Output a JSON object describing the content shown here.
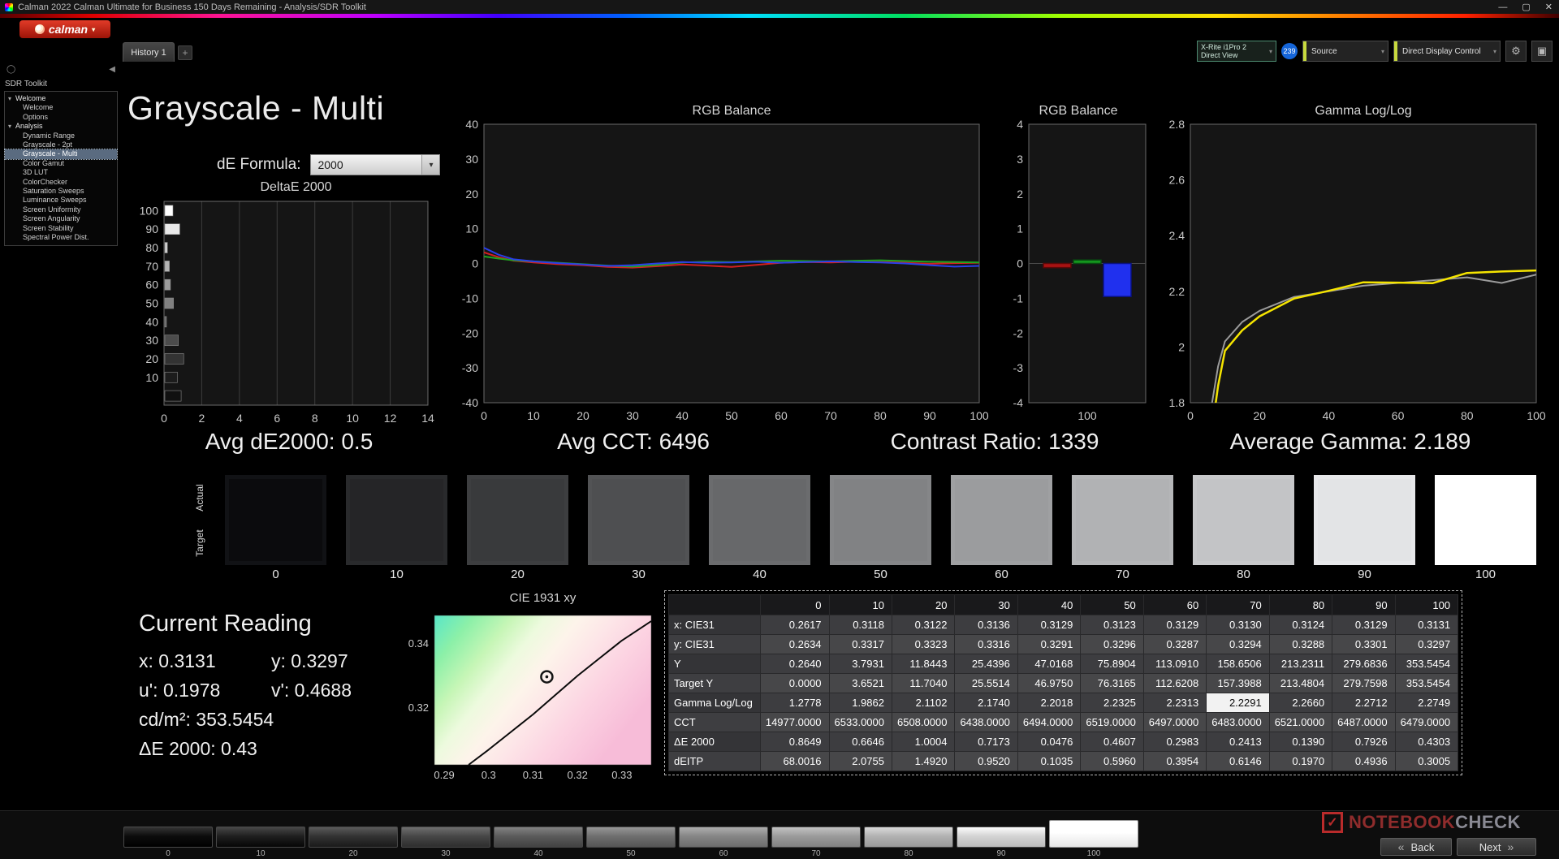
{
  "window": {
    "title": "Calman 2022 Calman Ultimate for Business 150 Days Remaining  - Analysis/SDR Toolkit",
    "minimize": "—",
    "maximize": "▢",
    "close": "✕"
  },
  "logo": {
    "text": "calman",
    "caret": "▾"
  },
  "tabs": {
    "history": "History 1",
    "add": "+"
  },
  "meter_bar": {
    "meter_line1": "X-Rite i1Pro 2",
    "meter_line2": "Direct View",
    "badge": "239",
    "source": "Source",
    "display_control": "Direct Display Control",
    "caret": "▾",
    "gear_icon": "⚙",
    "display_icon": "▣"
  },
  "sidebar": {
    "title": "SDR Toolkit",
    "menu_icon": "◯",
    "collapse_icon": "◀",
    "group_caret": "▾",
    "groups": [
      {
        "label": "Welcome",
        "items": [
          {
            "label": "Welcome"
          },
          {
            "label": "Options"
          }
        ]
      },
      {
        "label": "Analysis",
        "items": [
          {
            "label": "Dynamic Range"
          },
          {
            "label": "Grayscale - 2pt"
          },
          {
            "label": "Grayscale - Multi",
            "selected": true
          },
          {
            "label": "Color Gamut"
          },
          {
            "label": "3D LUT"
          },
          {
            "label": "ColorChecker"
          },
          {
            "label": "Saturation Sweeps"
          },
          {
            "label": "Luminance Sweeps"
          },
          {
            "label": "Screen Uniformity"
          },
          {
            "label": "Screen Angularity"
          },
          {
            "label": "Screen Stability"
          },
          {
            "label": "Spectral Power Dist."
          }
        ]
      }
    ]
  },
  "page": {
    "title": "Grayscale - Multi",
    "de_formula_label": "dE Formula:",
    "de_formula_value": "2000"
  },
  "stats": [
    {
      "id": "avg-de2000",
      "text": "Avg dE2000: 0.5"
    },
    {
      "id": "avg-cct",
      "text": "Avg CCT: 6496"
    },
    {
      "id": "contrast-ratio",
      "text": "Contrast Ratio: 1339"
    },
    {
      "id": "average-gamma",
      "text": "Average Gamma: 2.189"
    }
  ],
  "gray_swatches": {
    "actual_label": "Actual",
    "target_label": "Target",
    "levels": [
      "0",
      "10",
      "20",
      "30",
      "40",
      "50",
      "60",
      "70",
      "80",
      "90",
      "100"
    ],
    "actual_colors": [
      "#0b0b0d",
      "#252527",
      "#393a3c",
      "#4e4f51",
      "#67686a",
      "#818284",
      "#9b9c9e",
      "#b1b2b4",
      "#c3c4c6",
      "#e3e4e6",
      "#ffffff"
    ],
    "target_colors": [
      "#111215",
      "#292a2c",
      "#3d3e40",
      "#525355",
      "#6b6c6e",
      "#858688",
      "#9fa0a2",
      "#b5b6b8",
      "#c7c8ca",
      "#e7e8ea",
      "#ffffff"
    ]
  },
  "current_reading": {
    "title": "Current Reading",
    "rows": [
      [
        "x: 0.3131",
        "y: 0.3297"
      ],
      [
        "u': 0.1978",
        "v': 0.4688"
      ],
      [
        "cd/m²: 353.5454"
      ],
      [
        "ΔE 2000: 0.43"
      ]
    ]
  },
  "table": {
    "columns": [
      "0",
      "10",
      "20",
      "30",
      "40",
      "50",
      "60",
      "70",
      "80",
      "90",
      "100"
    ],
    "rows": [
      {
        "label": "x: CIE31",
        "values": [
          "0.2617",
          "0.3118",
          "0.3122",
          "0.3136",
          "0.3129",
          "0.3123",
          "0.3129",
          "0.3130",
          "0.3124",
          "0.3129",
          "0.3131"
        ]
      },
      {
        "label": "y: CIE31",
        "values": [
          "0.2634",
          "0.3317",
          "0.3323",
          "0.3316",
          "0.3291",
          "0.3296",
          "0.3287",
          "0.3294",
          "0.3288",
          "0.3301",
          "0.3297"
        ]
      },
      {
        "label": "Y",
        "values": [
          "0.2640",
          "3.7931",
          "11.8443",
          "25.4396",
          "47.0168",
          "75.8904",
          "113.0910",
          "158.6506",
          "213.2311",
          "279.6836",
          "353.5454"
        ]
      },
      {
        "label": "Target Y",
        "values": [
          "0.0000",
          "3.6521",
          "11.7040",
          "25.5514",
          "46.9750",
          "76.3165",
          "112.6208",
          "157.3988",
          "213.4804",
          "279.7598",
          "353.5454"
        ]
      },
      {
        "label": "Gamma Log/Log",
        "values": [
          "1.2778",
          "1.9862",
          "2.1102",
          "2.1740",
          "2.2018",
          "2.2325",
          "2.2313",
          "2.2291",
          "2.2660",
          "2.2712",
          "2.2749"
        ]
      },
      {
        "label": "CCT",
        "values": [
          "14977.0000",
          "6533.0000",
          "6508.0000",
          "6438.0000",
          "6494.0000",
          "6519.0000",
          "6497.0000",
          "6483.0000",
          "6521.0000",
          "6487.0000",
          "6479.0000"
        ]
      },
      {
        "label": "ΔE 2000",
        "values": [
          "0.8649",
          "0.6646",
          "1.0004",
          "0.7173",
          "0.0476",
          "0.4607",
          "0.2983",
          "0.2413",
          "0.1390",
          "0.7926",
          "0.4303"
        ]
      },
      {
        "label": "dEITP",
        "values": [
          "68.0016",
          "2.0755",
          "1.4920",
          "0.9520",
          "0.1035",
          "0.5960",
          "0.3954",
          "0.6146",
          "0.1970",
          "0.4936",
          "0.3005"
        ]
      }
    ],
    "highlight": {
      "row_index": 4,
      "col_index": 7
    }
  },
  "bottom_bar": {
    "levels": [
      "0",
      "10",
      "20",
      "30",
      "40",
      "50",
      "60",
      "70",
      "80",
      "90",
      "100"
    ],
    "selected_index": 10,
    "level_colors": [
      "#0c0c0c",
      "#1f1f1f",
      "#333333",
      "#474747",
      "#5b5b5b",
      "#6f6f6f",
      "#868686",
      "#9b9b9b",
      "#b2b2b2",
      "#d4d4d4",
      "#ffffff"
    ],
    "back": "Back",
    "next": "Next",
    "back_chevron": "«",
    "next_chevron": "»"
  },
  "watermark": {
    "check": "✓",
    "text_primary": "NOTEBOOK",
    "text_secondary": "CHECK"
  },
  "chart_data": [
    {
      "id": "deltae",
      "type": "bar",
      "orientation": "horizontal",
      "title": "DeltaE 2000",
      "categories": [
        100,
        90,
        80,
        70,
        60,
        50,
        40,
        30,
        20,
        10,
        0
      ],
      "values": [
        0.4303,
        0.7926,
        0.139,
        0.2413,
        0.2983,
        0.4607,
        0.0476,
        0.7173,
        1.0004,
        0.6646,
        0.8649
      ],
      "xlim": [
        0,
        14
      ],
      "xticks": [
        0,
        2,
        4,
        6,
        8,
        10,
        12,
        14
      ],
      "bar_colors": [
        "#ffffff",
        "#e9e9e9",
        "#cfcfcf",
        "#b5b5b5",
        "#9b9b9b",
        "#808080",
        "#666666",
        "#4c4c4c",
        "#333333",
        "#1c1c1c",
        "#101010"
      ]
    },
    {
      "id": "rgb-line",
      "type": "line",
      "title": "RGB Balance",
      "xlim": [
        0,
        100
      ],
      "ylim": [
        -40,
        40
      ],
      "xticks": [
        0,
        10,
        20,
        30,
        40,
        50,
        60,
        70,
        80,
        90,
        100
      ],
      "yticks": [
        40,
        30,
        20,
        10,
        0,
        -10,
        -20,
        -30,
        -40
      ],
      "x": [
        0,
        3,
        6,
        10,
        15,
        20,
        25,
        30,
        35,
        40,
        45,
        50,
        55,
        60,
        65,
        70,
        75,
        80,
        85,
        90,
        95,
        100
      ],
      "series": [
        {
          "name": "red",
          "color": "#d42020",
          "values": [
            3.2,
            1.8,
            0.8,
            0.3,
            -0.2,
            -0.5,
            -1.0,
            -1.2,
            -0.8,
            -0.3,
            -0.6,
            -1.0,
            -0.4,
            0.2,
            0.4,
            0.3,
            0.5,
            0.4,
            0.2,
            -0.1,
            0.1,
            0.2
          ]
        },
        {
          "name": "green",
          "color": "#1fa51f",
          "values": [
            2.0,
            1.4,
            0.9,
            0.6,
            0.2,
            -0.2,
            -0.6,
            -0.9,
            -0.4,
            0.3,
            0.5,
            0.4,
            0.6,
            0.8,
            0.7,
            0.6,
            0.8,
            0.9,
            0.7,
            0.5,
            0.4,
            0.3
          ]
        },
        {
          "name": "blue",
          "color": "#2a3fe8",
          "values": [
            4.5,
            2.5,
            1.2,
            0.6,
            0.1,
            -0.3,
            -0.7,
            -0.5,
            0.0,
            0.4,
            0.2,
            0.3,
            0.5,
            0.2,
            0.4,
            0.6,
            0.4,
            0.3,
            0.0,
            -0.5,
            -0.9,
            -0.7
          ]
        }
      ]
    },
    {
      "id": "rgb-bar",
      "type": "bar",
      "title": "RGB Balance",
      "ylim": [
        -4,
        4
      ],
      "yticks": [
        4,
        3,
        2,
        1,
        0,
        -1,
        -2,
        -3,
        -4
      ],
      "x_label": "100",
      "series": [
        {
          "name": "red",
          "color": "#a81212",
          "border": "#5c0808",
          "value": -0.12
        },
        {
          "name": "green",
          "color": "#14961e",
          "border": "#084c10",
          "value": 0.1
        },
        {
          "name": "blue",
          "color": "#2030ee",
          "border": "#0a1280",
          "value": -0.95
        }
      ]
    },
    {
      "id": "gamma",
      "type": "line",
      "title": "Gamma Log/Log",
      "xlim": [
        0,
        100
      ],
      "ylim": [
        1.8,
        2.8
      ],
      "xticks": [
        0,
        20,
        40,
        60,
        80,
        100
      ],
      "yticks": [
        2.8,
        2.6,
        2.4,
        2.2,
        2,
        1.8
      ],
      "x": [
        2,
        4,
        6,
        8,
        10,
        15,
        20,
        30,
        40,
        50,
        60,
        70,
        80,
        90,
        100
      ],
      "series": [
        {
          "name": "target",
          "color": "#9b9b9b",
          "width": 2,
          "values": [
            0.9,
            1.5,
            1.78,
            1.93,
            2.02,
            2.09,
            2.13,
            2.18,
            2.2,
            2.22,
            2.23,
            2.24,
            2.25,
            2.23,
            2.26
          ]
        },
        {
          "name": "measured",
          "color": "#f5e400",
          "width": 2.5,
          "values": [
            0.85,
            1.42,
            1.68,
            1.86,
            1.9862,
            2.06,
            2.1102,
            2.174,
            2.2018,
            2.2325,
            2.2313,
            2.2291,
            2.266,
            2.2712,
            2.2749
          ]
        }
      ]
    },
    {
      "id": "cie",
      "type": "scatter",
      "title": "CIE 1931 xy",
      "xlim": [
        0.2878,
        0.3366
      ],
      "ylim": [
        0.3023,
        0.3488
      ],
      "xticks": [
        0.29,
        0.3,
        0.31,
        0.32,
        0.33
      ],
      "yticks": [
        0.34,
        0.32
      ],
      "locus": [
        [
          0.2955,
          0.3023
        ],
        [
          0.3,
          0.307
        ],
        [
          0.305,
          0.3125
        ],
        [
          0.31,
          0.318
        ],
        [
          0.315,
          0.324
        ],
        [
          0.32,
          0.33
        ],
        [
          0.325,
          0.3355
        ],
        [
          0.33,
          0.341
        ],
        [
          0.3366,
          0.347
        ]
      ],
      "point": {
        "x": 0.3131,
        "y": 0.3297
      }
    }
  ]
}
